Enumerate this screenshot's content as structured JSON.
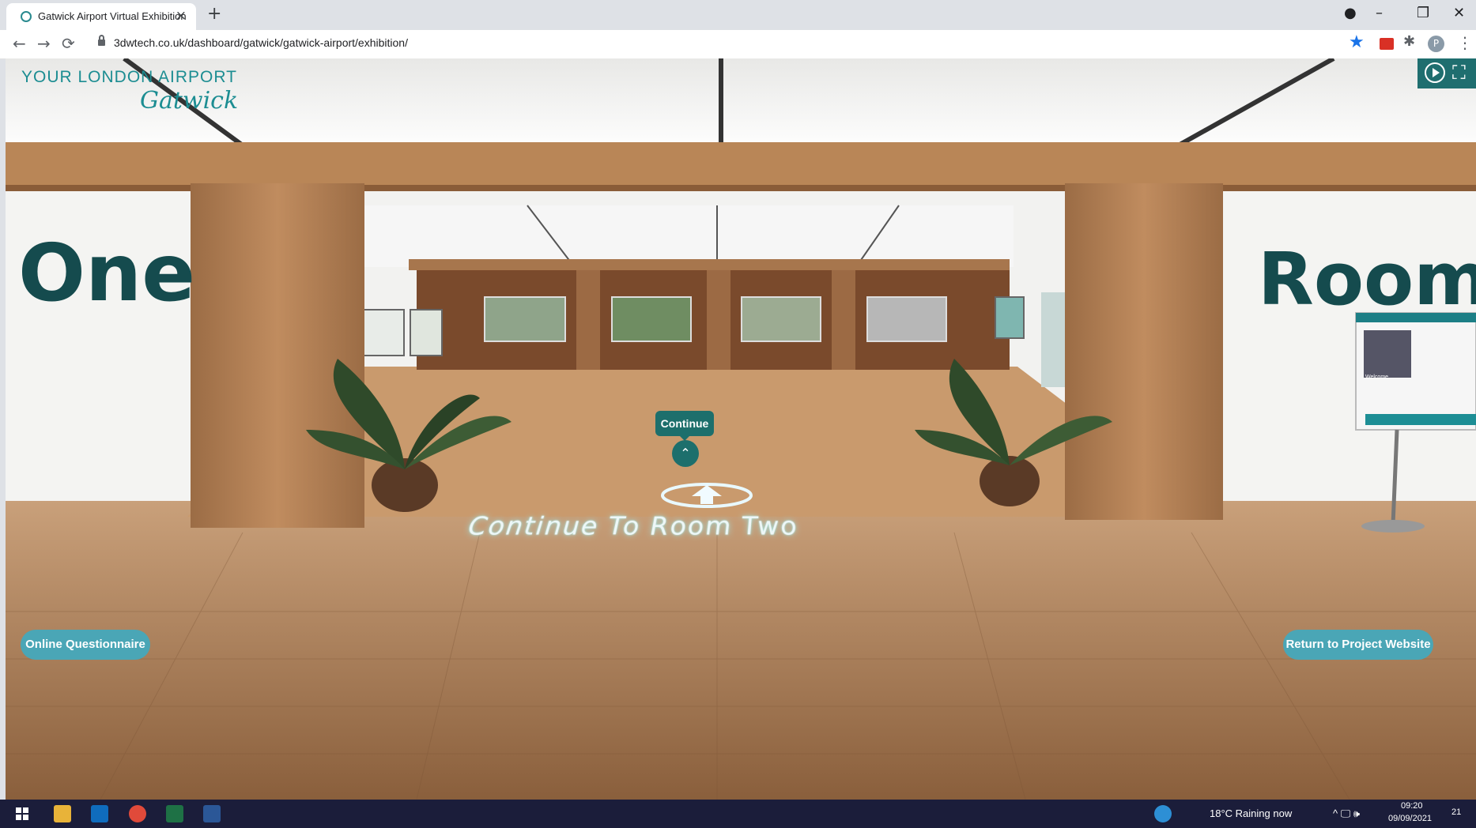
{
  "browser": {
    "tab_title": "Gatwick Airport Virtual Exhibition",
    "tab_close": "×",
    "new_tab": "+",
    "url": "3dwtech.co.uk/dashboard/gatwick/gatwick-airport/exhibition/",
    "profile_initial": "P",
    "nav": {
      "back": "←",
      "forward": "→",
      "reload": "⟳"
    },
    "window": {
      "media": "●",
      "minimize": "–",
      "restore": "❐",
      "close": "✕"
    },
    "bookmark_star": "★",
    "extensions_icon": "✱",
    "menu_icon": "⋮"
  },
  "exhibition": {
    "logo_line": "YOUR LONDON AIRPORT",
    "logo_script": "Gatwick",
    "left_wall_text": "One",
    "right_wall_text": "Room O",
    "continue_label": "Continue",
    "up_arrow": "⌃",
    "floor_text": "Continue To Room Two",
    "questionnaire_label": "Online Questionnaire",
    "return_label": "Return to Project Website",
    "welcome_board_title": "Welcome",
    "fullscreen_icon": "⛶"
  },
  "taskbar": {
    "weather": "18°C  Raining now",
    "time": "09:20",
    "date": "09/09/2021",
    "notifications": "21",
    "tray_icons": "^ 🖵 🕪"
  },
  "colors": {
    "brand_teal": "#1c8d92",
    "button_teal": "#1d6f6c",
    "pill_blue": "#4aa6b6",
    "taskbar": "#1b1d3a"
  }
}
